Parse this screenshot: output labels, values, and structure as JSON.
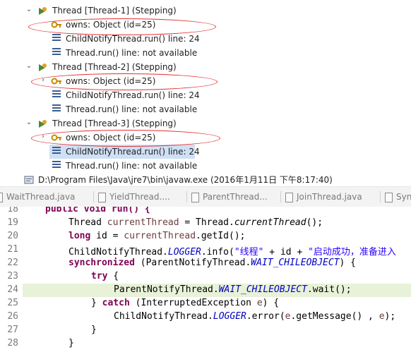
{
  "debug": {
    "threads": [
      {
        "label": "Thread [Thread-1] (Stepping)",
        "owns": "owns: Object  (id=25)",
        "frames": [
          "ChildNotifyThread.run() line: 24",
          "Thread.run() line: not available"
        ]
      },
      {
        "label": "Thread [Thread-2] (Stepping)",
        "owns": "owns: Object  (id=25)",
        "frames": [
          "ChildNotifyThread.run() line: 24",
          "Thread.run() line: not available"
        ]
      },
      {
        "label": "Thread [Thread-3] (Stepping)",
        "owns": "owns: Object  (id=25)",
        "frames": [
          "ChildNotifyThread.run() line: 24",
          "Thread.run() line: not available"
        ]
      }
    ],
    "process": "D:\\Program Files\\Java\\jre7\\bin\\javaw.exe (2016年1月11日 下午8:17:40)"
  },
  "tabs": [
    "WaitThread.java",
    "YieldThread....",
    "ParentThread...",
    "JoinThread.java",
    "Syn"
  ],
  "code": {
    "line_numbers": [
      "18",
      "19",
      "20",
      "21",
      "22",
      "23",
      "24",
      "25",
      "26",
      "27",
      "28"
    ],
    "line18": "public void run() {",
    "line19": {
      "a": "Thread ",
      "b": "currentThread",
      "c": " = Thread.",
      "d": "currentThread",
      "e": "();"
    },
    "line20": {
      "kw": "long",
      "a": " id = ",
      "b": "currentThread",
      "c": ".getId();"
    },
    "line21": {
      "a": "ChildNotifyThread.",
      "b": "LOGGER",
      "c": ".info(",
      "d": "\"线程\"",
      "e": " + id + ",
      "f": "\"启动成功，准备进入"
    },
    "line22": {
      "kw": "synchronized",
      "a": " (ParentNotifyThread.",
      "b": "WAIT_CHILEOBJECT",
      "c": ") {"
    },
    "line23": "try",
    "line23b": " {",
    "line24": {
      "a": "ParentNotifyThread.",
      "b": "WAIT_CHILEOBJECT",
      "c": ".wait();"
    },
    "line25": {
      "a": "} ",
      "kw": "catch",
      "b": " (InterruptedException ",
      "c": "e",
      "d": ") {"
    },
    "line26": {
      "a": "ChildNotifyThread.",
      "b": "LOGGER",
      "c": ".error(",
      "d": "e",
      "e": ".getMessage() , ",
      "f": "e",
      "g": ");"
    },
    "line27": "}",
    "line28": "}"
  },
  "colors": {
    "selection": "#cfe0f5",
    "current_line": "#e8f2d8",
    "annotation": "#e03030",
    "keyword": "#7f0055",
    "field": "#0000c0",
    "string": "#2a00ff"
  }
}
